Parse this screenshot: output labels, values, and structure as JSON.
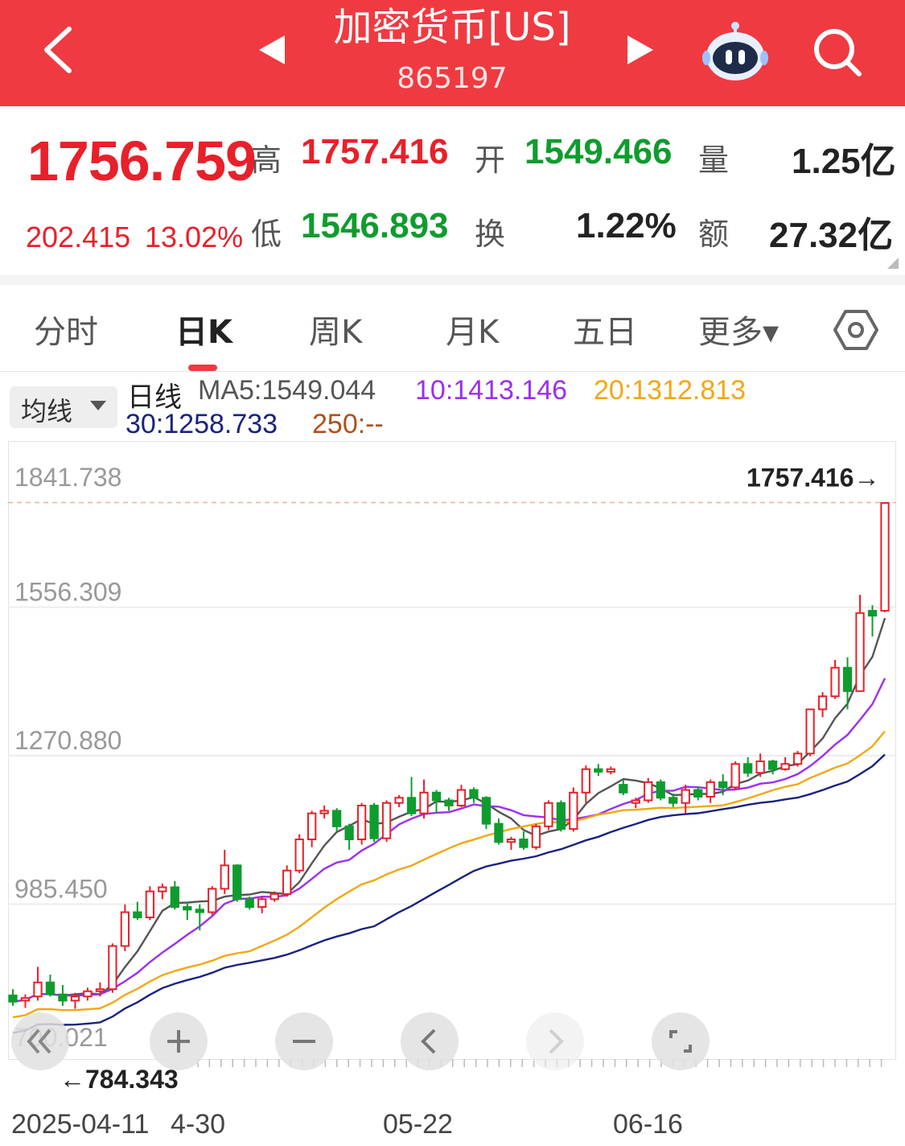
{
  "header": {
    "title": "加密货币[US]",
    "code": "865197"
  },
  "quote": {
    "price": "1756.759",
    "change": "202.415",
    "change_pct": "13.02%",
    "high_label": "高",
    "high": "1757.416",
    "low_label": "低",
    "low": "1546.893",
    "open_label": "开",
    "open": "1549.466",
    "turnover_label": "换",
    "turnover": "1.22%",
    "volume_label": "量",
    "volume": "1.25亿",
    "amount_label": "额",
    "amount": "27.32亿"
  },
  "tabs": [
    {
      "label": "分时",
      "active": false
    },
    {
      "label": "日K",
      "active": true
    },
    {
      "label": "周K",
      "active": false
    },
    {
      "label": "月K",
      "active": false
    },
    {
      "label": "五日",
      "active": false
    },
    {
      "label": "更多▾",
      "active": false
    }
  ],
  "ma_bar": {
    "select_label": "均线",
    "line_type": "日线",
    "ma5": "MA5:1549.044",
    "ma10": "10:1413.146",
    "ma20": "20:1312.813",
    "ma30": "30:1258.733",
    "ma250": "250:--"
  },
  "colors": {
    "brand": "#ef3a41",
    "up": "#e8202a",
    "down": "#0f9c2e",
    "ma5": "#555555",
    "ma10": "#9b2ff0",
    "ma20": "#f3a714",
    "ma30": "#1a237e",
    "ma250": "#b0501c"
  },
  "controls": {
    "reset_icon": "double-chevron-left-icon",
    "zoom_in_icon": "plus-icon",
    "zoom_out_icon": "minus-icon",
    "left_icon": "chevron-left-icon",
    "right_icon": "chevron-right-icon",
    "fullscreen_icon": "fullscreen-icon"
  },
  "chart_data": {
    "type": "candlestick",
    "y_ticks": [
      "1841.738",
      "1556.309",
      "1270.880",
      "985.450",
      "700.021"
    ],
    "ylim": [
      700.021,
      1841.738
    ],
    "x_ticks": [
      "2025-04-11",
      "4-30",
      "05-22",
      "06-16"
    ],
    "max_label": "1757.416→",
    "min_label": "←784.343",
    "candles": [
      [
        810,
        822,
        790,
        798
      ],
      [
        800,
        812,
        786,
        805
      ],
      [
        808,
        865,
        800,
        835
      ],
      [
        835,
        850,
        808,
        812
      ],
      [
        812,
        830,
        790,
        800
      ],
      [
        800,
        815,
        784.343,
        808
      ],
      [
        808,
        825,
        800,
        818
      ],
      [
        818,
        835,
        808,
        822
      ],
      [
        822,
        910,
        815,
        905
      ],
      [
        905,
        985,
        895,
        970
      ],
      [
        970,
        990,
        955,
        960
      ],
      [
        960,
        1020,
        955,
        1010
      ],
      [
        1010,
        1025,
        995,
        1018
      ],
      [
        1018,
        1030,
        975,
        980
      ],
      [
        980,
        990,
        955,
        975
      ],
      [
        975,
        985,
        935,
        970
      ],
      [
        970,
        1020,
        965,
        1015
      ],
      [
        1015,
        1090,
        1005,
        1060
      ],
      [
        1060,
        1062,
        990,
        995
      ],
      [
        995,
        1000,
        975,
        980
      ],
      [
        980,
        1000,
        968,
        995
      ],
      [
        995,
        1010,
        990,
        1005
      ],
      [
        1005,
        1060,
        1000,
        1050
      ],
      [
        1050,
        1120,
        1045,
        1110
      ],
      [
        1110,
        1165,
        1095,
        1160
      ],
      [
        1160,
        1175,
        1150,
        1165
      ],
      [
        1165,
        1170,
        1125,
        1135
      ],
      [
        1135,
        1140,
        1090,
        1110
      ],
      [
        1110,
        1180,
        1100,
        1175
      ],
      [
        1175,
        1180,
        1105,
        1112
      ],
      [
        1112,
        1185,
        1105,
        1180
      ],
      [
        1180,
        1195,
        1172,
        1190
      ],
      [
        1190,
        1230,
        1155,
        1160
      ],
      [
        1160,
        1225,
        1150,
        1200
      ],
      [
        1200,
        1205,
        1160,
        1185
      ],
      [
        1185,
        1190,
        1165,
        1175
      ],
      [
        1175,
        1215,
        1172,
        1205
      ],
      [
        1205,
        1210,
        1180,
        1190
      ],
      [
        1190,
        1193,
        1130,
        1140
      ],
      [
        1140,
        1150,
        1100,
        1105
      ],
      [
        1105,
        1115,
        1090,
        1110
      ],
      [
        1110,
        1125,
        1090,
        1095
      ],
      [
        1095,
        1140,
        1090,
        1135
      ],
      [
        1135,
        1185,
        1128,
        1180
      ],
      [
        1180,
        1185,
        1125,
        1130
      ],
      [
        1130,
        1210,
        1125,
        1200
      ],
      [
        1200,
        1252,
        1180,
        1245
      ],
      [
        1245,
        1255,
        1232,
        1240
      ],
      [
        1240,
        1250,
        1235,
        1245
      ],
      [
        1215,
        1225,
        1195,
        1200
      ],
      [
        1180,
        1190,
        1170,
        1185
      ],
      [
        1185,
        1228,
        1180,
        1220
      ],
      [
        1220,
        1225,
        1185,
        1190
      ],
      [
        1190,
        1198,
        1172,
        1180
      ],
      [
        1180,
        1215,
        1160,
        1205
      ],
      [
        1205,
        1212,
        1185,
        1192
      ],
      [
        1192,
        1225,
        1180,
        1220
      ],
      [
        1220,
        1235,
        1195,
        1210
      ],
      [
        1210,
        1260,
        1205,
        1255
      ],
      [
        1255,
        1268,
        1230,
        1238
      ],
      [
        1238,
        1275,
        1230,
        1260
      ],
      [
        1260,
        1263,
        1235,
        1245
      ],
      [
        1245,
        1268,
        1242,
        1255
      ],
      [
        1255,
        1280,
        1250,
        1275
      ],
      [
        1275,
        1350,
        1270,
        1360
      ],
      [
        1360,
        1393,
        1345,
        1385
      ],
      [
        1385,
        1455,
        1380,
        1440
      ],
      [
        1440,
        1460,
        1360,
        1395
      ],
      [
        1395,
        1580,
        1480,
        1545
      ],
      [
        1549.466,
        1560,
        1500,
        1540
      ],
      [
        1549.466,
        1757.416,
        1546.893,
        1756.759
      ]
    ],
    "series": [
      {
        "name": "MA5",
        "key": "ma5"
      },
      {
        "name": "10",
        "key": "ma10"
      },
      {
        "name": "20",
        "key": "ma20"
      },
      {
        "name": "30",
        "key": "ma30"
      }
    ]
  }
}
